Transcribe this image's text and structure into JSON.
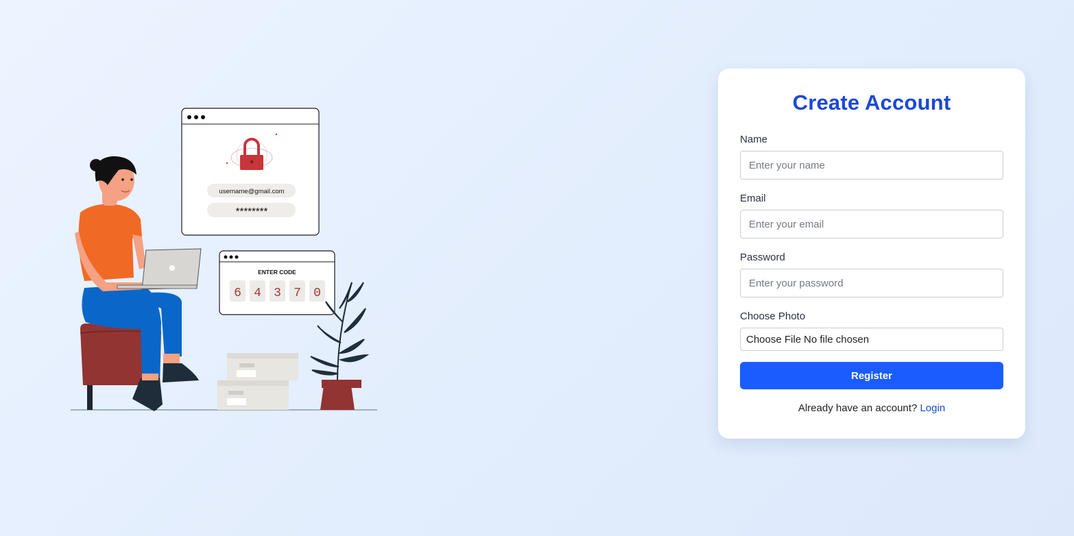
{
  "illustration": {
    "email_text": "username@gmail.com",
    "password_mask": "********",
    "code_title": "ENTER CODE",
    "code_digits": [
      "6",
      "4",
      "3",
      "7",
      "0"
    ]
  },
  "form": {
    "title": "Create Account",
    "name_label": "Name",
    "name_placeholder": "Enter your name",
    "email_label": "Email",
    "email_placeholder": "Enter your email",
    "password_label": "Password",
    "password_placeholder": "Enter your password",
    "photo_label": "Choose Photo",
    "file_button": "Choose File",
    "file_status": "No file chosen",
    "register_label": "Register",
    "login_prompt": "Already have an account?",
    "login_link": "Login"
  },
  "colors": {
    "title": "#1b48d6",
    "button": "#1a5cff",
    "link": "#1b48d6",
    "shirt": "#f06a25",
    "pants": "#0a66c9",
    "stool": "#913432",
    "lock": "#c8353a"
  }
}
